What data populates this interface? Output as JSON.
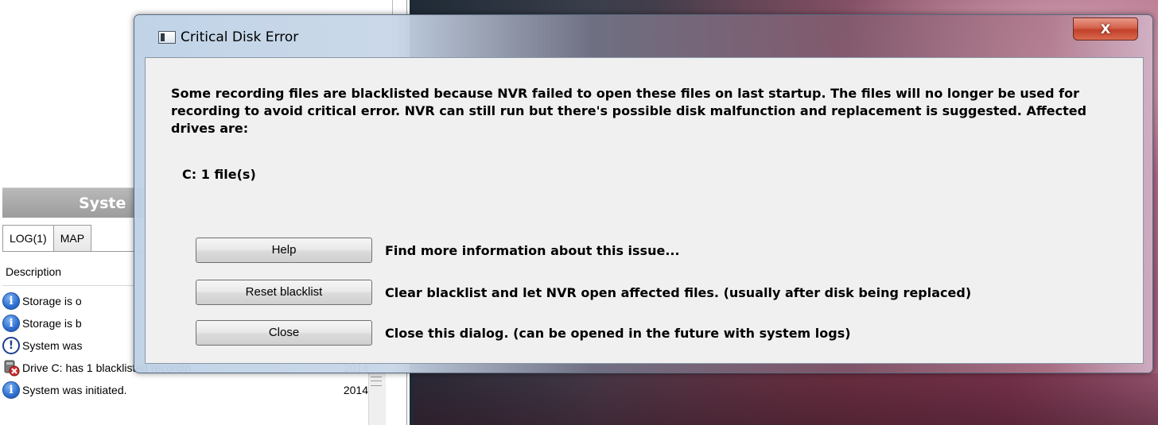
{
  "syslog": {
    "title": "Syste",
    "tabs": [
      {
        "label": "LOG(1)",
        "active": true
      },
      {
        "label": "MAP",
        "active": false
      }
    ],
    "column_description": "Description",
    "rows": [
      {
        "icon": "info-icon",
        "description": "Storage is o",
        "date": ""
      },
      {
        "icon": "info-icon",
        "description": "Storage is b",
        "date": ""
      },
      {
        "icon": "warning-icon",
        "description": "System was",
        "date": ""
      },
      {
        "icon": "drive-error-icon",
        "description": "Drive C: has 1 blacklisted recordin…",
        "date": "2014"
      },
      {
        "icon": "info-icon",
        "description": "System was initiated.",
        "date": "2014"
      }
    ]
  },
  "dialog": {
    "title": "Critical Disk Error",
    "close_glyph": "X",
    "message": "Some recording files are blacklisted because NVR failed to open these files on last startup. The files will no longer be used for recording to avoid critical error. NVR can still run but there's possible disk malfunction and replacement is suggested. Affected drives are:",
    "drives": "C: 1 file(s)",
    "actions": [
      {
        "button": "Help",
        "description": "Find more information about this issue..."
      },
      {
        "button": "Reset blacklist",
        "description": "Clear blacklist and let NVR open affected files. (usually after disk being replaced)"
      },
      {
        "button": "Close",
        "description": "Close this dialog. (can be opened in the future with system logs)"
      }
    ]
  },
  "colors": {
    "close_button": "#c8482f",
    "info_icon": "#2e6fd0",
    "dialog_body": "#f0f0f0"
  }
}
